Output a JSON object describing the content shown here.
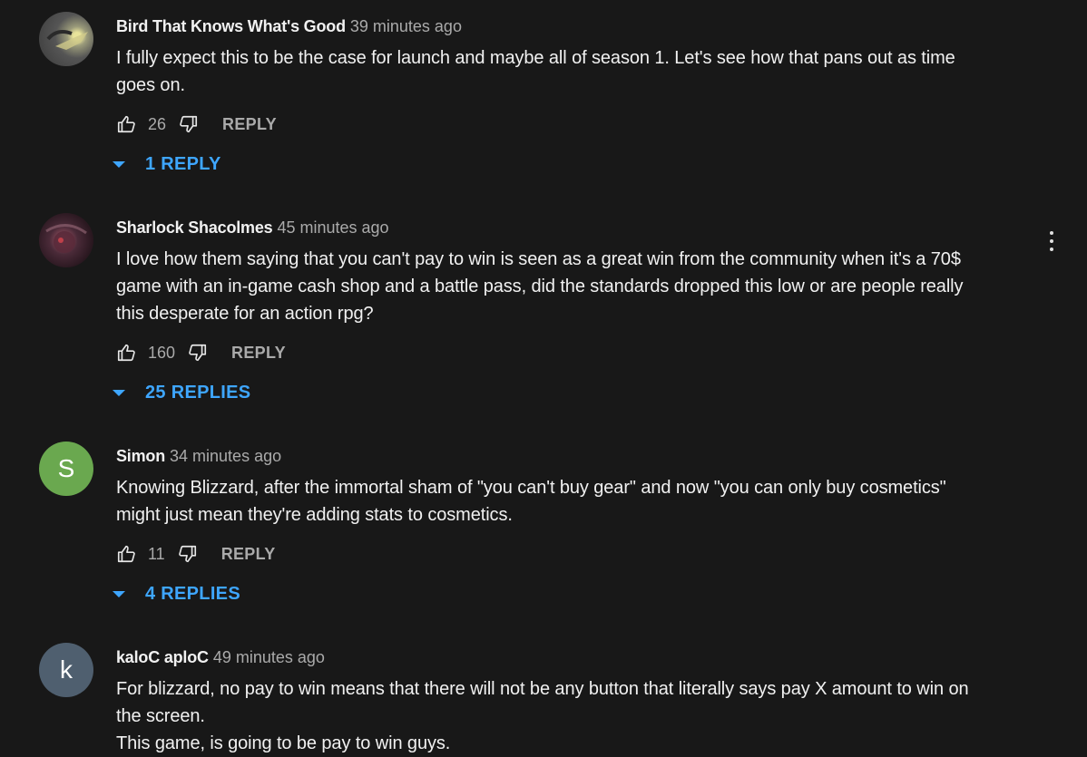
{
  "comments": [
    {
      "author": "Bird That Knows What's Good",
      "time": "39 minutes ago",
      "lines": [
        "I fully expect this to be the case for launch and maybe all of season 1. Let's see how that pans out as time",
        "goes on."
      ],
      "likes": "26",
      "reply_label": "REPLY",
      "replies_label": "1 REPLY",
      "avatar": {
        "type": "image",
        "icon": "bird-avatar",
        "colors": [
          "#6a6a6a",
          "#c9c37a"
        ]
      }
    },
    {
      "author": "Sharlock Shacolmes",
      "time": "45 minutes ago",
      "lines": [
        "I love how them saying that you can't pay to win is seen as a great win from the community when it's a 70$",
        "game with an in-game cash shop and a battle pass, did the standards dropped this low or are people really",
        "this desperate for an action rpg?"
      ],
      "likes": "160",
      "reply_label": "REPLY",
      "replies_label": "25 REPLIES",
      "avatar": {
        "type": "image",
        "icon": "dark-creature-avatar",
        "colors": [
          "#2c1a24",
          "#8a4a5a"
        ]
      }
    },
    {
      "author": "Simon",
      "time": "34 minutes ago",
      "lines": [
        "Knowing Blizzard, after the immortal sham of \"you can't buy gear\" and now \"you can only buy cosmetics\"",
        "might just mean they're adding stats to cosmetics."
      ],
      "likes": "11",
      "reply_label": "REPLY",
      "replies_label": "4 REPLIES",
      "avatar": {
        "type": "letter",
        "letter": "S",
        "color": "#6aa84f"
      }
    },
    {
      "author": "kaloC aploC",
      "time": "49 minutes ago",
      "lines": [
        "For blizzard, no pay to win means that there will not be any button that literally says pay X amount to win on",
        "the screen.",
        "This game, is going to be pay to win guys."
      ],
      "avatar": {
        "type": "letter",
        "letter": "k",
        "color": "#4f5f6f"
      }
    }
  ],
  "icons": {
    "like": "thumb-up-icon",
    "dislike": "thumb-down-icon",
    "more": "more-vertical-icon",
    "expand": "caret-down-icon"
  },
  "colors": {
    "background": "#181818",
    "link": "#3ea6ff",
    "muted": "#aaaaaa"
  }
}
